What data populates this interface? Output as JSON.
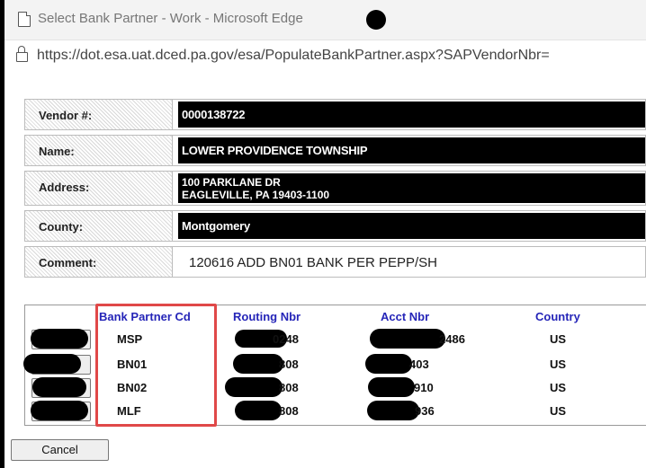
{
  "window": {
    "title": "Select Bank Partner - Work - Microsoft Edge",
    "url": "https://dot.esa.uat.dced.pa.gov/esa/PopulateBankPartner.aspx?SAPVendorNbr="
  },
  "form": {
    "vendor_label": "Vendor #:",
    "vendor_value": "0000138722",
    "name_label": "Name:",
    "name_value": "LOWER PROVIDENCE TOWNSHIP",
    "address_label": "Address:",
    "address_line1": "100 PARKLANE DR",
    "address_line2": "EAGLEVILLE, PA 19403-1100",
    "county_label": "County:",
    "county_value": "Montgomery",
    "comment_label": "Comment:",
    "comment_value": "120616 ADD BN01 BANK PER PEPP/SH"
  },
  "grid": {
    "headers": {
      "bank_partner_cd": "Bank Partner Cd",
      "routing_nbr": "Routing Nbr",
      "acct_nbr": "Acct Nbr",
      "country": "Country"
    },
    "rows": [
      {
        "bank_partner_cd": "MSP",
        "routing_nbr": "0248",
        "acct_nbr": "2486",
        "country": "US"
      },
      {
        "bank_partner_cd": "BN01",
        "routing_nbr": "808",
        "acct_nbr": "403",
        "country": "US"
      },
      {
        "bank_partner_cd": "BN02",
        "routing_nbr": "808",
        "acct_nbr": "910",
        "country": "US"
      },
      {
        "bank_partner_cd": "MLF",
        "routing_nbr": "808",
        "acct_nbr": "936",
        "country": "US"
      }
    ]
  },
  "buttons": {
    "cancel": "Cancel"
  },
  "colors": {
    "header_link": "#2525b8",
    "highlight": "#e04848"
  },
  "icons": {
    "title": "page-icon",
    "address": "lock-icon"
  }
}
